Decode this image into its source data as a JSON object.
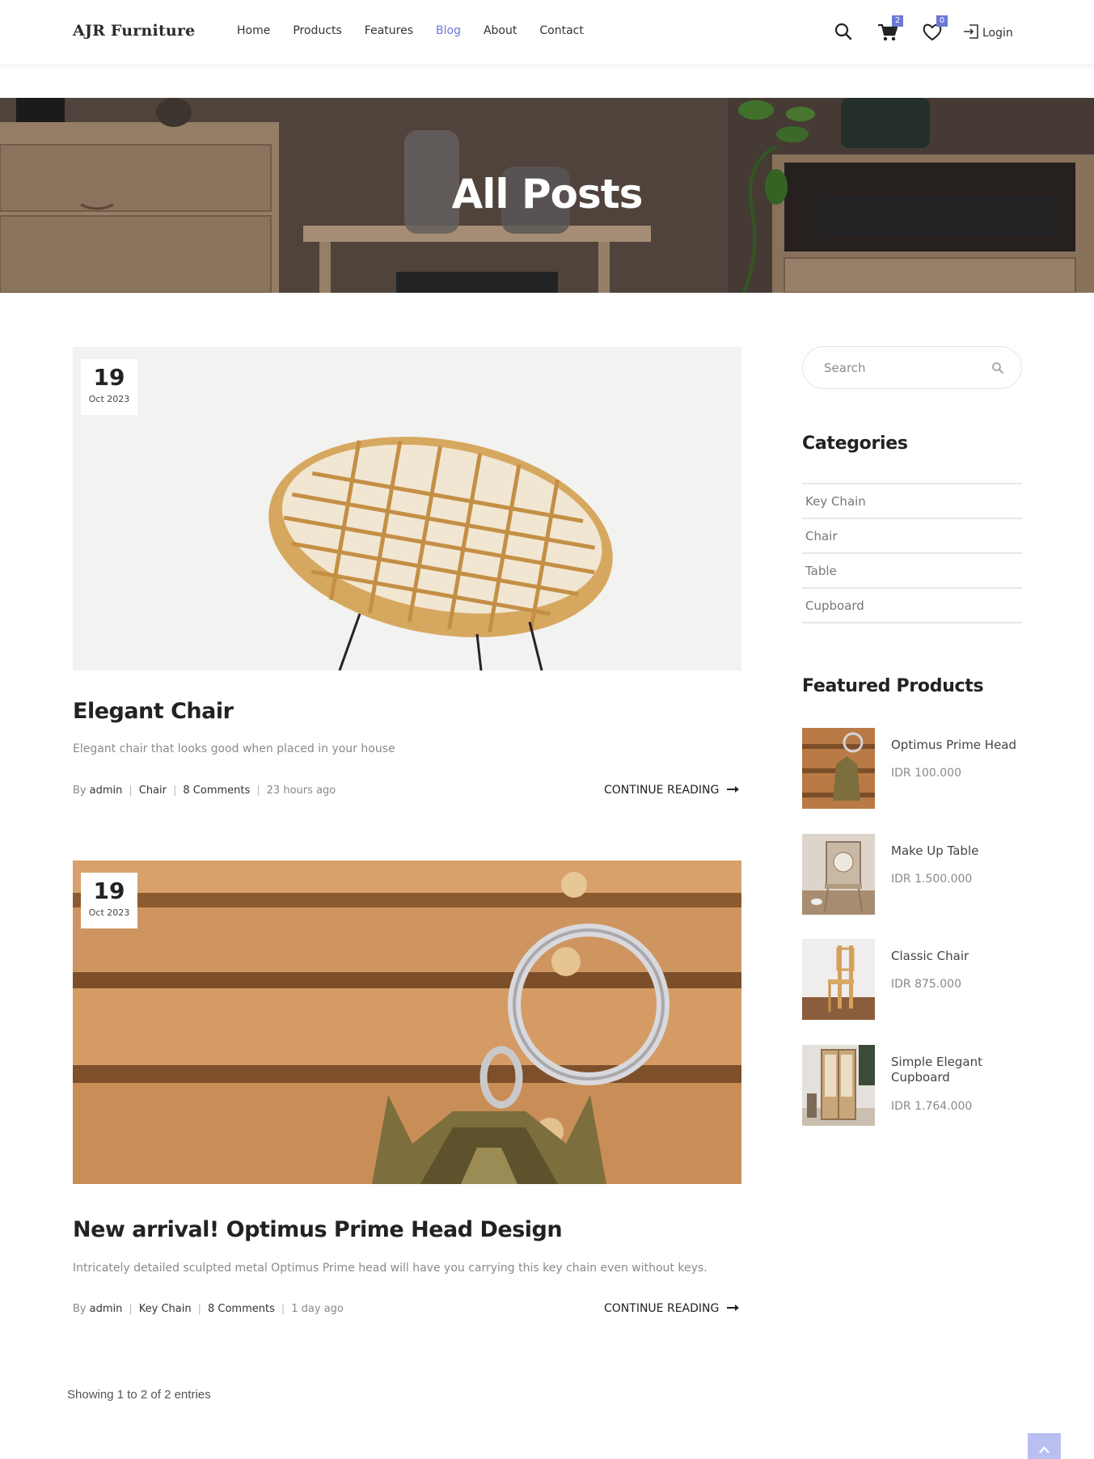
{
  "brand": {
    "name": "AJR Furniture"
  },
  "nav": [
    {
      "label": "Home",
      "active": false
    },
    {
      "label": "Products",
      "active": false
    },
    {
      "label": "Features",
      "active": false
    },
    {
      "label": "Blog",
      "active": true
    },
    {
      "label": "About",
      "active": false
    },
    {
      "label": "Contact",
      "active": false
    }
  ],
  "header_actions": {
    "search_icon": "search-icon",
    "cart_icon": "cart-icon",
    "cart_count": "2",
    "wishlist_icon": "heart-icon",
    "wishlist_count": "0",
    "login_icon": "login-icon",
    "login_label": "Login"
  },
  "hero": {
    "title": "All Posts"
  },
  "posts": [
    {
      "day": "19",
      "month_year": "Oct 2023",
      "title": "Elegant Chair",
      "excerpt": "Elegant chair that looks good when placed in your house",
      "by": "By",
      "author": "admin",
      "category": "Chair",
      "comments": "8 Comments",
      "time": "23 hours ago",
      "read_more": "CONTINUE READING"
    },
    {
      "day": "19",
      "month_year": "Oct 2023",
      "title": "New arrival! Optimus Prime Head Design",
      "excerpt": "Intricately detailed sculpted metal Optimus Prime head will have you carrying this key chain even without keys.",
      "by": "By",
      "author": "admin",
      "category": "Key Chain",
      "comments": "8 Comments",
      "time": "1 day ago",
      "read_more": "CONTINUE READING"
    }
  ],
  "pagination": {
    "showing": "Showing 1 to 2 of 2 entries"
  },
  "sidebar": {
    "search_placeholder": "Search",
    "categories_title": "Categories",
    "categories": [
      "Key Chain",
      "Chair",
      "Table",
      "Cupboard"
    ],
    "featured_title": "Featured Products",
    "featured": [
      {
        "name": "Optimus Prime Head",
        "price": "IDR 100.000"
      },
      {
        "name": "Make Up Table",
        "price": "IDR 1.500.000"
      },
      {
        "name": "Classic Chair",
        "price": "IDR 875.000"
      },
      {
        "name": "Simple Elegant Cupboard",
        "price": "IDR 1.764.000"
      }
    ]
  },
  "colors": {
    "accent": "#6b78d6",
    "to_top": "#b9bff0"
  },
  "back_to_top_icon": "chevron-up-icon"
}
